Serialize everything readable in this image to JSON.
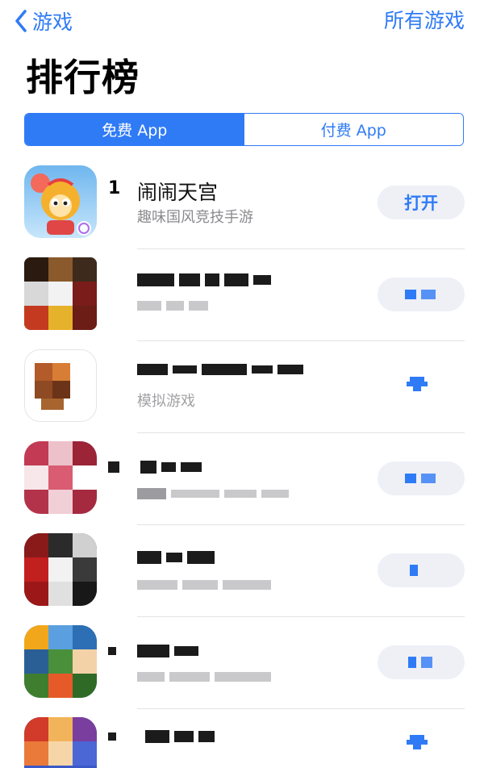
{
  "nav": {
    "back_label": "游戏",
    "right_label": "所有游戏"
  },
  "page_title": "排行榜",
  "segments": [
    {
      "label": "免费 App",
      "active": true
    },
    {
      "label": "付费 App",
      "active": false
    }
  ],
  "apps": [
    {
      "rank": "1",
      "name": "闹闹天宫",
      "subtitle": "趣味国风竞技手游",
      "action": "打开"
    },
    {
      "rank": "",
      "name": "",
      "subtitle": "",
      "action": ""
    },
    {
      "rank": "",
      "name": "",
      "subtitle": "模拟游戏",
      "action": ""
    },
    {
      "rank": "",
      "name": "",
      "subtitle": "",
      "action": ""
    },
    {
      "rank": "",
      "name": "",
      "subtitle": "",
      "action": ""
    },
    {
      "rank": "",
      "name": "",
      "subtitle": "",
      "action": ""
    },
    {
      "rank": "",
      "name": "",
      "subtitle": "",
      "action": ""
    }
  ],
  "colors": {
    "accent": "#2f7bf6",
    "button_bg": "#eef0f6",
    "secondary_text": "#8a8a8e"
  }
}
